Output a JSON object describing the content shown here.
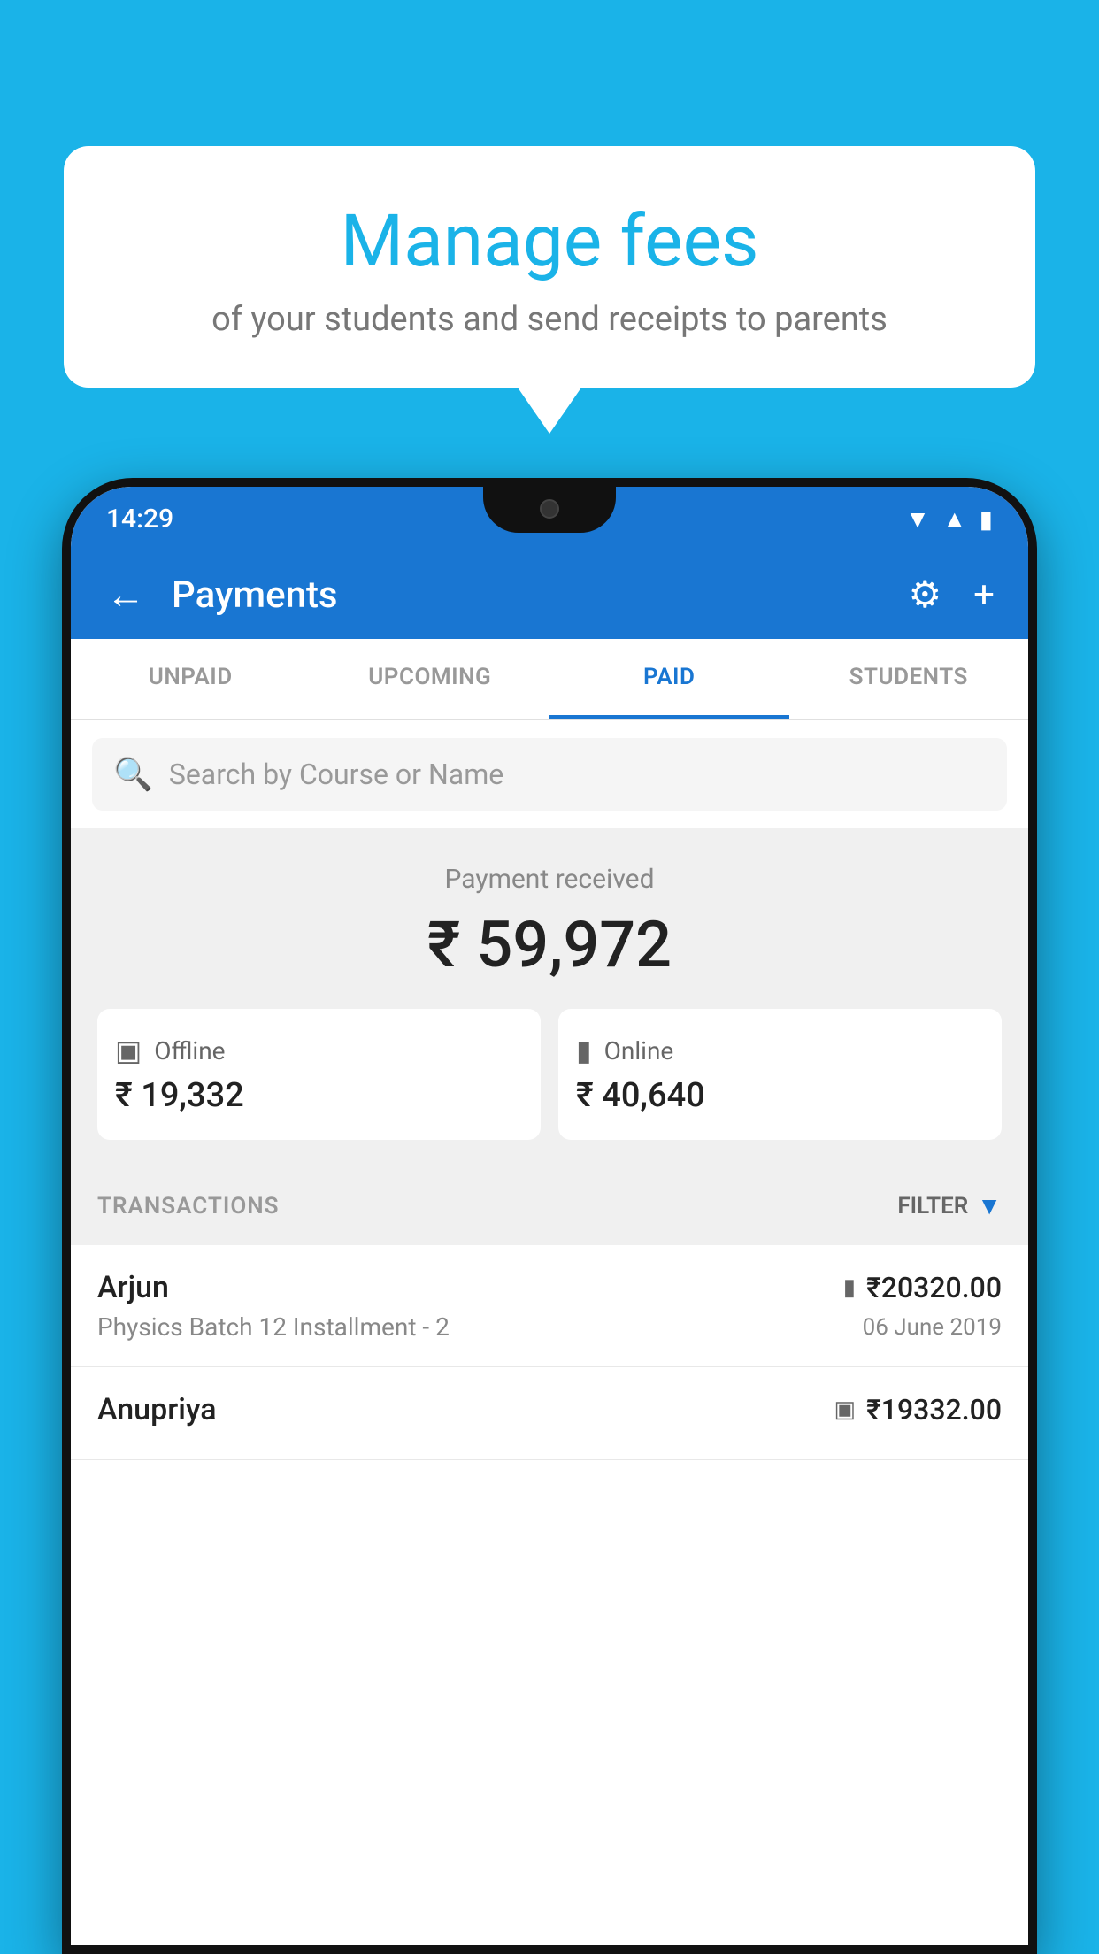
{
  "page": {
    "background_color": "#1ab3e8"
  },
  "bubble": {
    "title": "Manage fees",
    "subtitle": "of your students and send receipts to parents"
  },
  "status_bar": {
    "time": "14:29",
    "wifi_icon": "▼",
    "signal_icon": "▲",
    "battery_icon": "▮"
  },
  "app_bar": {
    "back_icon": "←",
    "title": "Payments",
    "settings_icon": "⚙",
    "add_icon": "+"
  },
  "tabs": [
    {
      "label": "UNPAID",
      "active": false
    },
    {
      "label": "UPCOMING",
      "active": false
    },
    {
      "label": "PAID",
      "active": true
    },
    {
      "label": "STUDENTS",
      "active": false
    }
  ],
  "search": {
    "placeholder": "Search by Course or Name"
  },
  "payment_summary": {
    "label": "Payment received",
    "amount": "₹ 59,972",
    "offline": {
      "icon": "💳",
      "label": "Offline",
      "amount": "₹ 19,332"
    },
    "online": {
      "icon": "💳",
      "label": "Online",
      "amount": "₹ 40,640"
    }
  },
  "transactions": {
    "label": "TRANSACTIONS",
    "filter_label": "FILTER",
    "items": [
      {
        "name": "Arjun",
        "amount": "₹20320.00",
        "course": "Physics Batch 12 Installment - 2",
        "date": "06 June 2019",
        "type": "online"
      },
      {
        "name": "Anupriya",
        "amount": "₹19332.00",
        "course": "",
        "date": "",
        "type": "offline"
      }
    ]
  }
}
